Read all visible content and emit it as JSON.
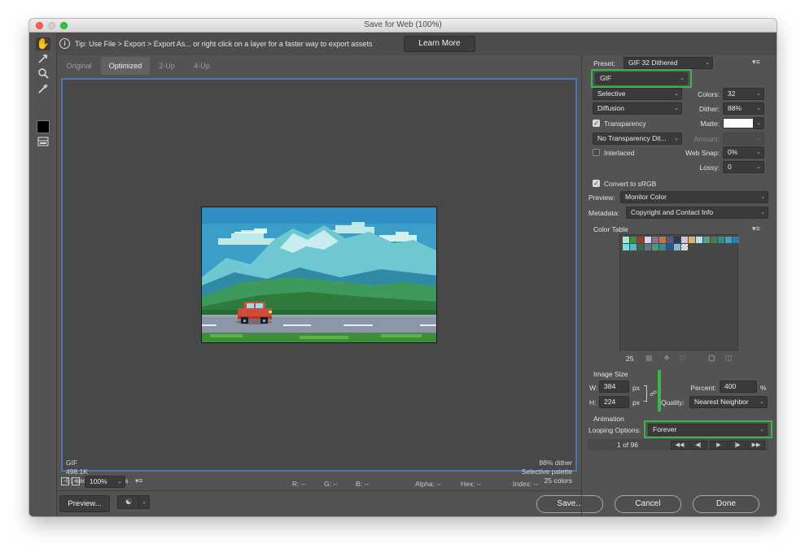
{
  "window": {
    "title": "Save for Web (100%)"
  },
  "tipbar": {
    "text": "Tip: Use File > Export > Export As...  or right click on a layer for a faster way to export assets",
    "learn_more": "Learn More"
  },
  "tabs": [
    "Original",
    "Optimized",
    "2-Up",
    "4-Up"
  ],
  "active_tab": "Optimized",
  "canvas": {
    "info_left": [
      "GIF",
      "498.1K",
      "91 sec @ 56.6 Kbps"
    ],
    "info_right": [
      "88% dither",
      "Selective palette",
      "25 colors"
    ]
  },
  "statusbar": {
    "zoom": "100%",
    "r": "R: --",
    "g": "G: --",
    "b": "B: --",
    "alpha": "Alpha: --",
    "hex": "Hex: --",
    "index": "Index: --"
  },
  "bottom": {
    "preview": "Preview...",
    "save": "Save...",
    "cancel": "Cancel",
    "done": "Done"
  },
  "settings": {
    "preset_label": "Preset:",
    "preset_value": "GIF 32 Dithered",
    "format": "GIF",
    "reduction": "Selective",
    "colors_label": "Colors:",
    "colors_value": "32",
    "dither_algo": "Diffusion",
    "dither_label": "Dither:",
    "dither_value": "88%",
    "transparency_label": "Transparency",
    "matte_label": "Matte:",
    "transparency_dither": "No Transparency Dit...",
    "amount_label": "Amount:",
    "interlaced_label": "Interlaced",
    "websnap_label": "Web Snap:",
    "websnap_value": "0%",
    "lossy_label": "Lossy:",
    "lossy_value": "0",
    "srgb_label": "Convert to sRGB",
    "preview_label": "Preview:",
    "preview_value": "Monitor Color",
    "metadata_label": "Metadata:",
    "metadata_value": "Copyright and Contact Info"
  },
  "color_table": {
    "title": "Color Table",
    "count": "25",
    "swatches_row1": [
      "#9fe8d6",
      "#3d8f3a",
      "#9a3b33",
      "#d6d6e8",
      "#8a6da0",
      "#c9724f",
      "#5d5a77",
      "#2c3a5a",
      "#cfc3d8",
      "#d9b46b",
      "#aee3f0",
      "#5f9a8a",
      "#4d7a4c",
      "#2f8e8c",
      "#3fa0b7",
      "#2d7eb0"
    ],
    "swatches_row2": [
      "#7fd6e6",
      "#5ab9c9",
      "#2f6e3e",
      "#6f6e86",
      "#4d9c6f",
      "#3a8a9e",
      "#1f5a8a",
      "#8fb5c8"
    ]
  },
  "image_size": {
    "title": "Image Size",
    "w_label": "W:",
    "w_value": "384",
    "px": "px",
    "h_label": "H:",
    "h_value": "224",
    "percent_label": "Percent:",
    "percent_value": "400",
    "pct": "%",
    "quality_label": "Quality:",
    "quality_value": "Nearest Neighbor"
  },
  "animation": {
    "title": "Animation",
    "looping_label": "Looping Options:",
    "looping_value": "Forever",
    "frame_counter": "1 of 96"
  }
}
